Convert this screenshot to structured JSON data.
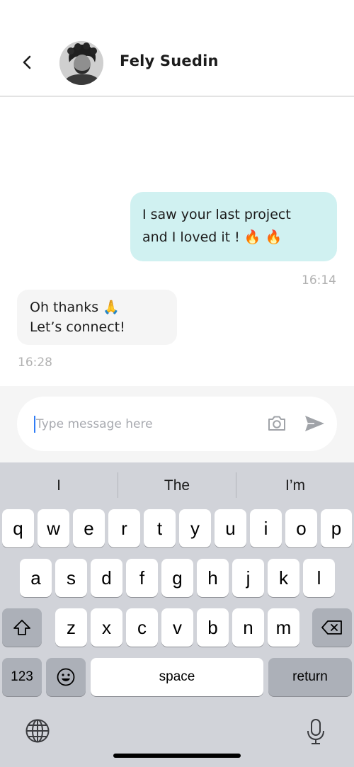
{
  "header": {
    "back_icon": "chevron-left-icon",
    "contact_name": "Fely Suedin"
  },
  "messages": [
    {
      "direction": "outgoing",
      "lines": [
        "I saw your last project",
        "and I loved it ! 🔥 🔥"
      ],
      "time": "16:14",
      "bubble_color": "#d0f1f1"
    },
    {
      "direction": "incoming",
      "lines": [
        "Oh thanks 🙏",
        "Let’s connect!"
      ],
      "time": "16:28",
      "bubble_color": "#f5f5f5"
    }
  ],
  "composer": {
    "placeholder": "Type message here",
    "value": "",
    "camera_icon": "camera-icon",
    "send_icon": "send-icon"
  },
  "keyboard": {
    "suggestions": [
      "I",
      "The",
      "I’m"
    ],
    "row1": [
      "q",
      "w",
      "e",
      "r",
      "t",
      "y",
      "u",
      "i",
      "o",
      "p"
    ],
    "row2": [
      "a",
      "s",
      "d",
      "f",
      "g",
      "h",
      "j",
      "k",
      "l"
    ],
    "row3": [
      "z",
      "x",
      "c",
      "v",
      "b",
      "n",
      "m"
    ],
    "numbers_label": "123",
    "space_label": "space",
    "return_label": "return",
    "shift_icon": "shift-icon",
    "delete_icon": "delete-icon",
    "emoji_icon": "emoji-icon",
    "globe_icon": "globe-icon",
    "mic_icon": "microphone-icon"
  },
  "colors": {
    "accent": "#2f7cf6",
    "timestamp": "#b2b2b2",
    "keyboard_bg": "#d1d3d9"
  }
}
